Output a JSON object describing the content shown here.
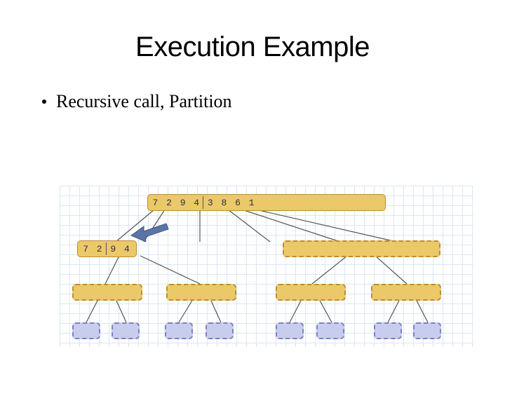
{
  "title": "Execution Example",
  "bullet": "Recursive call, Partition",
  "nodes": {
    "root": "7 2 9 4  3 8 6 1",
    "root_left": "7 2 9 4",
    "root_right": "3 8 6 1",
    "l1_left": "7 2  9 4"
  },
  "colors": {
    "yellow_fill": "#ecc968",
    "yellow_border": "#bb8b36",
    "blue_fill": "#c8cdee",
    "blue_border": "#7f7fbf",
    "grid": "#dbe7f2",
    "arrow": "#5b74a8"
  }
}
